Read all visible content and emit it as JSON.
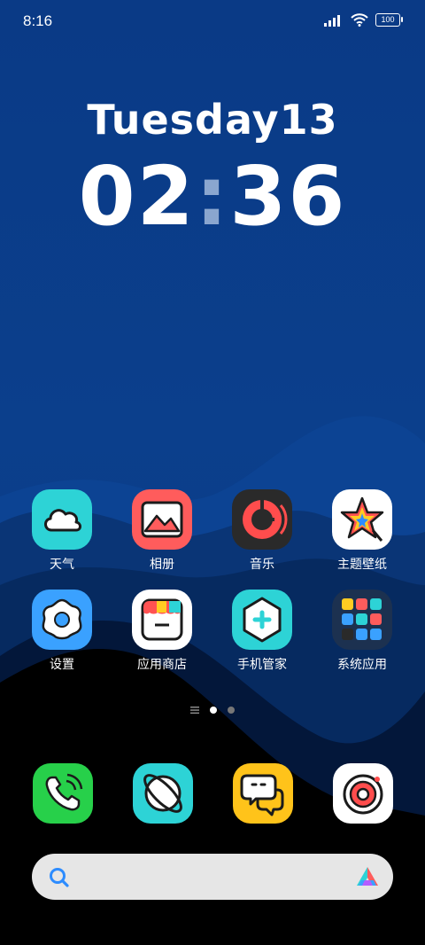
{
  "status_bar": {
    "time": "8:16",
    "battery": "100"
  },
  "clock": {
    "date": "Tuesday13",
    "hour": "02",
    "minute": "36"
  },
  "apps_row1": [
    {
      "label": "天气"
    },
    {
      "label": "相册"
    },
    {
      "label": "音乐"
    },
    {
      "label": "主题壁纸"
    }
  ],
  "apps_row2": [
    {
      "label": "设置"
    },
    {
      "label": "应用商店"
    },
    {
      "label": "手机管家"
    },
    {
      "label": "系统应用"
    }
  ],
  "colors": {
    "weather": "#2dd3d6",
    "gallery": "#ff5c5c",
    "music": "#2a2a2a",
    "settings": "#3aa1ff",
    "phone": "#27d04a",
    "messages": "#ffc31a"
  },
  "dock": {
    "icons": [
      "phone-icon",
      "browser-icon",
      "messages-icon",
      "camera-icon"
    ]
  },
  "search": {
    "icon": "search-icon"
  }
}
